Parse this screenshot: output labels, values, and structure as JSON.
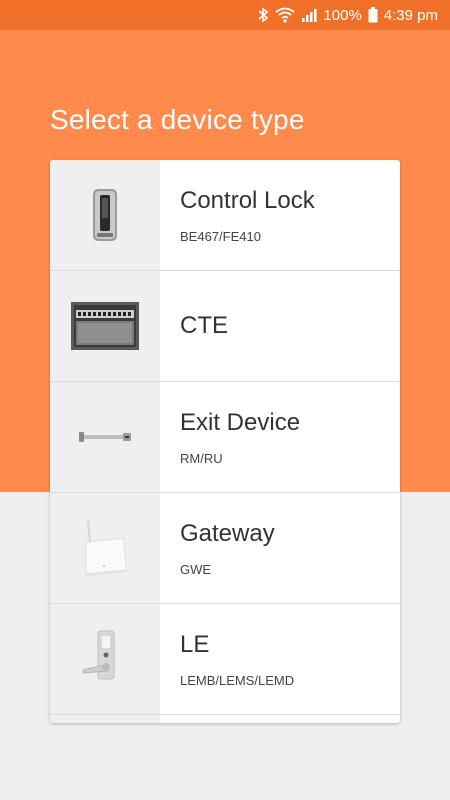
{
  "status_bar": {
    "battery": "100%",
    "time": "4:39 pm",
    "icons": [
      "bluetooth-icon",
      "wifi-icon",
      "signal-icon",
      "battery-icon"
    ]
  },
  "page": {
    "title": "Select a device type"
  },
  "colors": {
    "status_bar": "#f0702a",
    "header": "#ff8a4c",
    "background": "#efefef"
  },
  "devices": [
    {
      "name": "Control Lock",
      "model": "BE467/FE410",
      "image": "control-lock-icon"
    },
    {
      "name": "CTE",
      "model": "",
      "image": "cte-board-icon"
    },
    {
      "name": "Exit Device",
      "model": "RM/RU",
      "image": "exit-device-icon"
    },
    {
      "name": "Gateway",
      "model": "GWE",
      "image": "gateway-icon"
    },
    {
      "name": "LE",
      "model": "LEMB/LEMS/LEMD",
      "image": "le-lock-icon"
    }
  ]
}
